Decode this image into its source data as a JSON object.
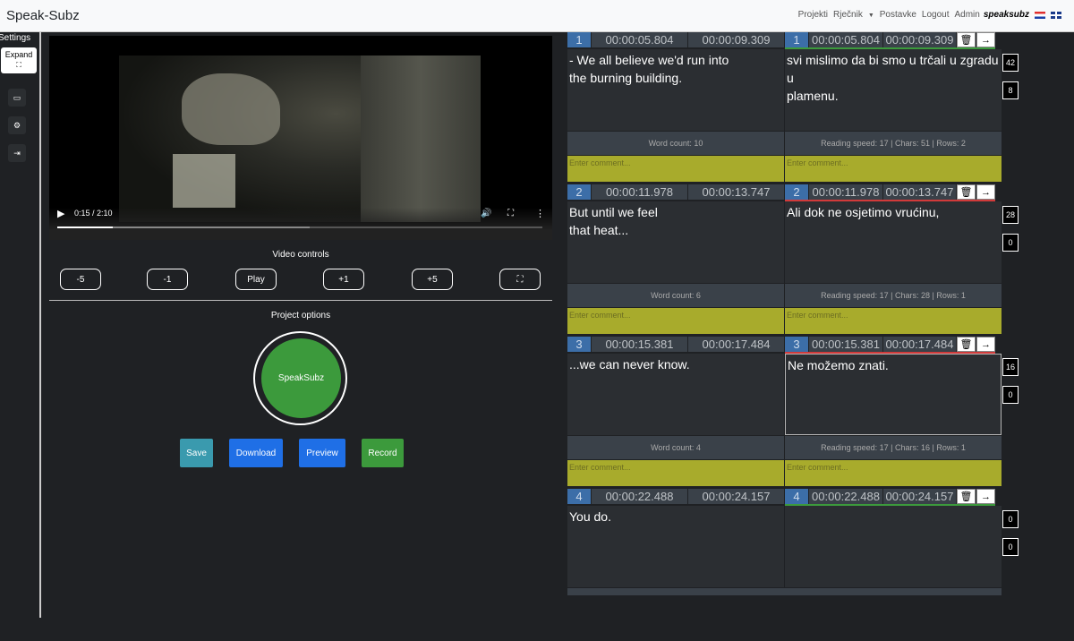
{
  "navbar": {
    "brand": "Speak-Subz",
    "links": [
      "Projekti",
      "Rječnik",
      "Postavke",
      "Logout",
      "Admin"
    ],
    "username": "speaksubz"
  },
  "sidebar": {
    "title": "Settings",
    "expand_label": "Expand",
    "icons": [
      "video-icon",
      "gear-icon",
      "export-icon"
    ]
  },
  "video": {
    "time": "0:15 / 2:10",
    "progress_fraction": 0.115,
    "buffered_fraction": 0.52
  },
  "video_controls": {
    "title": "Video controls",
    "buttons": [
      "-5",
      "-1",
      "Play",
      "+1",
      "+5"
    ]
  },
  "project_options": {
    "title": "Project options",
    "circle_label": "SpeakSubz",
    "actions": [
      {
        "label": "Save",
        "color": "#3a9aae"
      },
      {
        "label": "Download",
        "color": "#1f6fe6"
      },
      {
        "label": "Preview",
        "color": "#1f6fe6"
      },
      {
        "label": "Record",
        "color": "#3c9a3c"
      }
    ]
  },
  "subtitles": [
    {
      "number": "1",
      "start": "00:00:05.804",
      "end": "00:00:09.309",
      "source_lines": [
        "- We all believe we'd run into",
        "the burning building."
      ],
      "target_lines": [
        "svi mislimo da bi smo u trčali u zgradu",
        "u",
        "plamenu."
      ],
      "word_count": "Word count: 10",
      "reading": "Reading speed: 17 | Chars: 51 | Rows: 2",
      "comment_placeholder": "Enter comment...",
      "count_a": "42",
      "count_b": "8",
      "line_color": "green"
    },
    {
      "number": "2",
      "start": "00:00:11.978",
      "end": "00:00:13.747",
      "source_lines": [
        "But until we feel",
        "that heat..."
      ],
      "target_lines": [
        "Ali dok ne osjetimo vrućinu,"
      ],
      "word_count": "Word count: 6",
      "reading": "Reading speed: 17 | Chars: 28 | Rows: 1",
      "comment_placeholder": "Enter comment...",
      "count_a": "28",
      "count_b": "0",
      "line_color": "red"
    },
    {
      "number": "3",
      "start": "00:00:15.381",
      "end": "00:00:17.484",
      "source_lines": [
        "...we can never know."
      ],
      "target_lines": [
        "Ne možemo znati."
      ],
      "word_count": "Word count: 4",
      "reading": "Reading speed: 17 | Chars: 16 | Rows: 1",
      "comment_placeholder": "Enter comment...",
      "count_a": "16",
      "count_b": "0",
      "line_color": "red"
    },
    {
      "number": "4",
      "start": "00:00:22.488",
      "end": "00:00:24.157",
      "source_lines": [
        "You do."
      ],
      "target_lines": [],
      "word_count": "",
      "reading": "",
      "comment_placeholder": "",
      "count_a": "0",
      "count_b": "0",
      "line_color": "green"
    }
  ],
  "colors": {
    "line_green": "#3c9a3c",
    "line_red": "#d23a3a"
  }
}
